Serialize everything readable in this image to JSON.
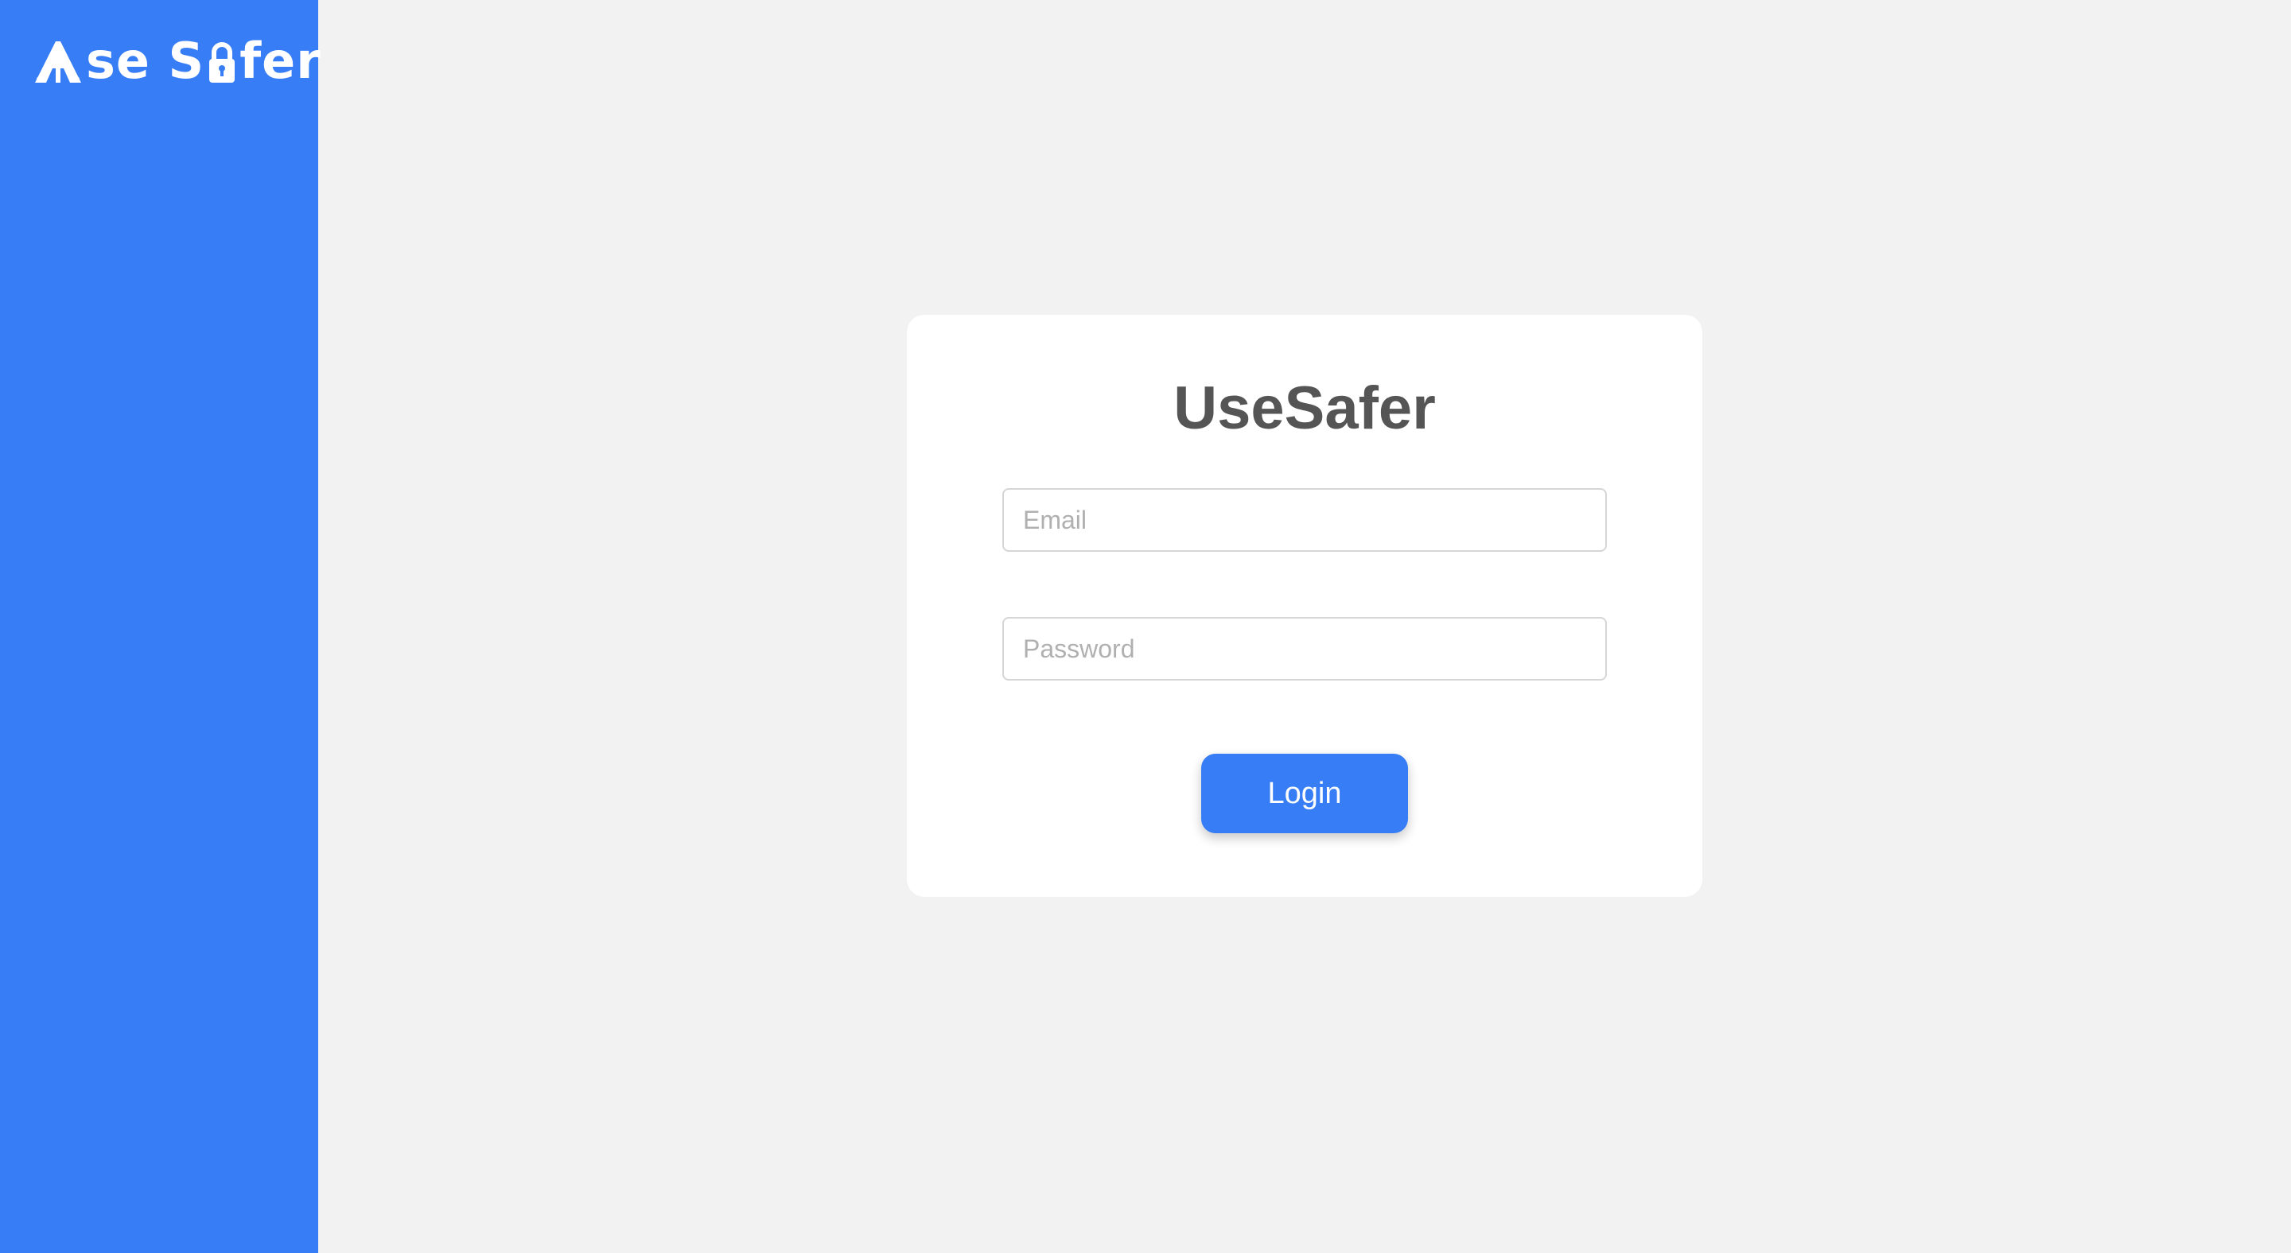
{
  "sidebar": {
    "logo": {
      "text_part_1": "se S",
      "text_part_2": "fer",
      "full_text": "Use Safer",
      "color": "#ffffff"
    },
    "background_color": "#377ef6"
  },
  "login_card": {
    "title": "UseSafer",
    "email": {
      "placeholder": "Email",
      "value": ""
    },
    "password": {
      "placeholder": "Password",
      "value": ""
    },
    "login_label": "Login"
  },
  "colors": {
    "accent": "#377ef6",
    "page_background": "#f2f2f2",
    "card_background": "#ffffff",
    "title_text": "#555555"
  }
}
